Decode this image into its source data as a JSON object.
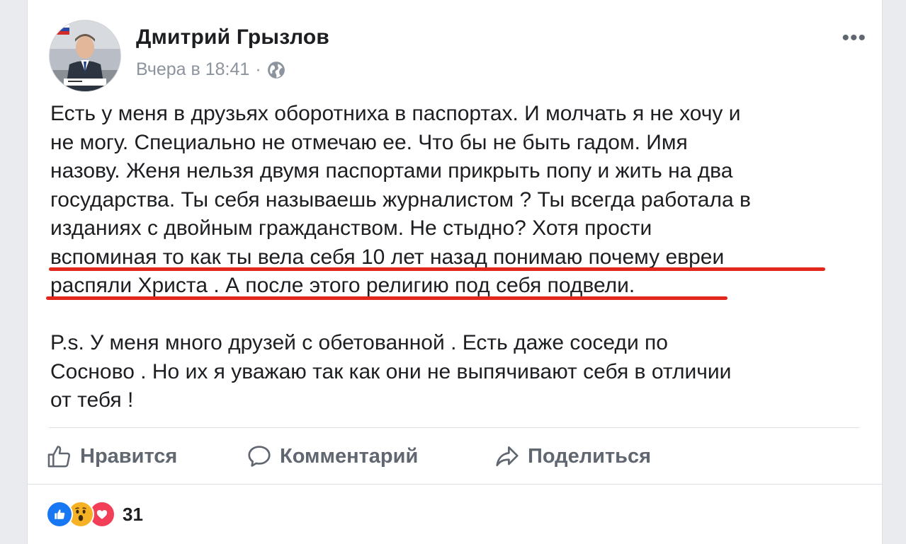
{
  "post": {
    "author": "Дмитрий Грызлов",
    "timestamp": "Вчера в 18:41",
    "separator": "·",
    "privacy_icon": "globe-icon",
    "more_label": "•••",
    "text_lines": [
      "Есть у меня в друзьях оборотниха в паспортах. И молчать я не хочу и",
      "не могу. Специально не отмечаю ее. Что бы не быть гадом. Имя",
      "назову. Женя нельзя двумя паспортами прикрыть попу и жить на два",
      "государства. Ты себя называешь журналистом ? Ты всегда работала в",
      "изданиях с двойным гражданством. Не стыдно? Хотя прости",
      "вспоминая то как ты вела себя 10 лет назад понимаю почему евреи",
      "распяли Христа . А после этого религию под себя подвели."
    ],
    "ps_lines": [
      "P.s. У меня много друзей с обетованной . Есть даже соседи по",
      "Сосново . Но их я уважаю так как они не выпячивают себя в отличии",
      "от тебя !"
    ],
    "highlight_color": "#e1261c"
  },
  "actions": {
    "like_label": "Нравится",
    "comment_label": "Комментарий",
    "share_label": "Поделиться"
  },
  "reactions": {
    "icons": [
      "like-icon",
      "wow-icon",
      "love-icon"
    ],
    "count": "31"
  },
  "colors": {
    "background": "#e9ebee",
    "text": "#1c1e21",
    "secondary": "#606770",
    "meta": "#8d949e",
    "like_blue": "#1877f2",
    "wow_yellow": "#f7b125",
    "love_red": "#f33e58"
  }
}
